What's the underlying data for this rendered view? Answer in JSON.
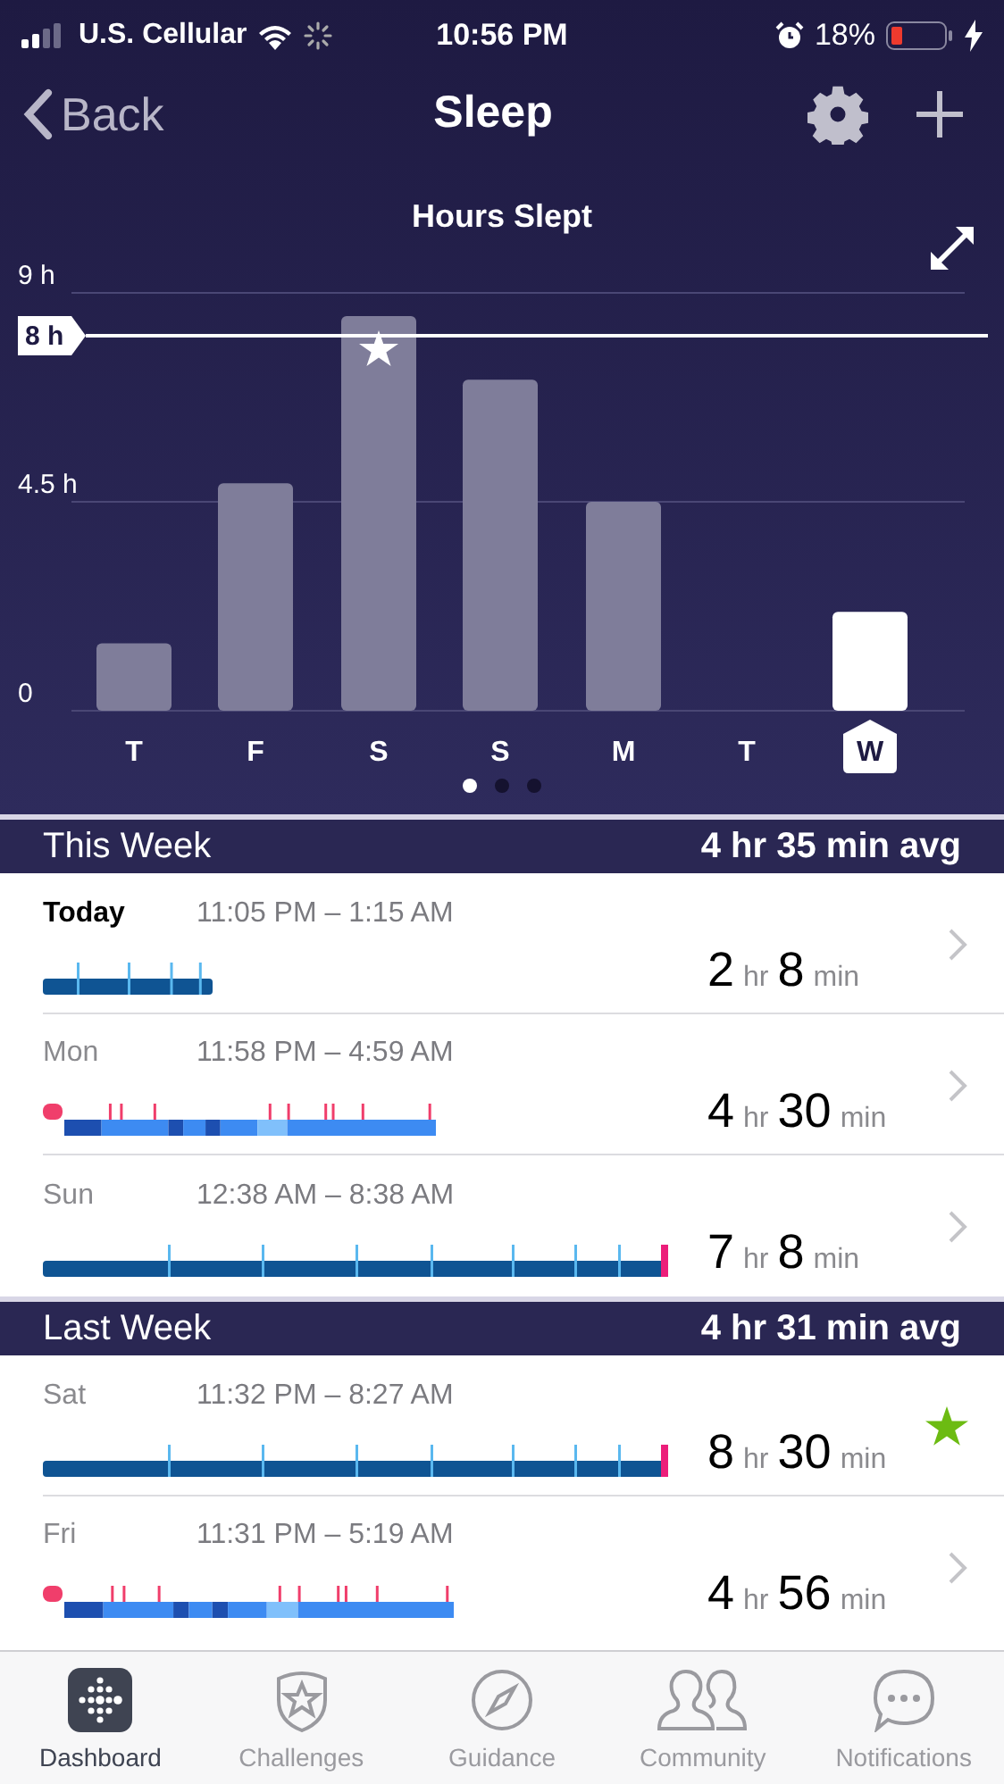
{
  "status_bar": {
    "carrier": "U.S. Cellular",
    "time": "10:56 PM",
    "battery": "18%"
  },
  "nav": {
    "back": "Back",
    "title": "Sleep"
  },
  "chart": {
    "title": "Hours Slept",
    "goal_label": "8 h",
    "chart_data": {
      "type": "bar",
      "categories": [
        "T",
        "F",
        "S",
        "S",
        "M",
        "T",
        "W"
      ],
      "values": [
        1.45,
        4.9,
        8.5,
        7.13,
        4.5,
        null,
        2.13
      ],
      "ylim": [
        0,
        9
      ],
      "yticks": [
        {
          "value": 0,
          "label": "0"
        },
        {
          "value": 4.5,
          "label": "4.5 h"
        },
        {
          "value": 9,
          "label": "9 h"
        }
      ]
    },
    "bars": [
      {
        "selected": false,
        "starred": false
      },
      {
        "selected": false,
        "starred": false
      },
      {
        "selected": false,
        "starred": true
      },
      {
        "selected": false,
        "starred": false
      },
      {
        "selected": false,
        "starred": false
      },
      {
        "selected": false,
        "starred": false
      },
      {
        "selected": true,
        "starred": false
      }
    ],
    "pages": [
      {
        "selected": true
      },
      {
        "selected": false
      },
      {
        "selected": false
      }
    ]
  },
  "sections": [
    {
      "title": "This Week",
      "average": "4 hr 35 min avg",
      "entries": [
        {
          "day": "Today",
          "current": true,
          "time": "11:05 PM – 1:15 AM",
          "kind": "classic",
          "duration": [
            {
              "value": "2",
              "unit": "hr"
            },
            {
              "value": "8",
              "unit": "min"
            }
          ],
          "starred": false
        },
        {
          "day": "Mon",
          "current": false,
          "time": "11:58 PM – 4:59 AM",
          "kind": "stages",
          "duration": [
            {
              "value": "4",
              "unit": "hr"
            },
            {
              "value": "30",
              "unit": "min"
            }
          ],
          "starred": false
        },
        {
          "day": "Sun",
          "current": false,
          "time": "12:38 AM – 8:38 AM",
          "kind": "classic",
          "duration": [
            {
              "value": "7",
              "unit": "hr"
            },
            {
              "value": "8",
              "unit": "min"
            }
          ],
          "starred": false
        }
      ]
    },
    {
      "title": "Last Week",
      "average": "4 hr 31 min avg",
      "entries": [
        {
          "day": "Sat",
          "current": false,
          "time": "11:32 PM – 8:27 AM",
          "kind": "classic",
          "duration": [
            {
              "value": "8",
              "unit": "hr"
            },
            {
              "value": "30",
              "unit": "min"
            }
          ],
          "starred": true
        },
        {
          "day": "Fri",
          "current": false,
          "time": "11:31 PM – 5:19 AM",
          "kind": "stages",
          "duration": [
            {
              "value": "4",
              "unit": "hr"
            },
            {
              "value": "56",
              "unit": "min"
            }
          ],
          "starred": false
        }
      ]
    }
  ],
  "tabs": [
    {
      "label": "Dashboard",
      "selected": true
    },
    {
      "label": "Challenges",
      "selected": false
    },
    {
      "label": "Guidance",
      "selected": false
    },
    {
      "label": "Community",
      "selected": false
    },
    {
      "label": "Notifications",
      "selected": false
    }
  ]
}
